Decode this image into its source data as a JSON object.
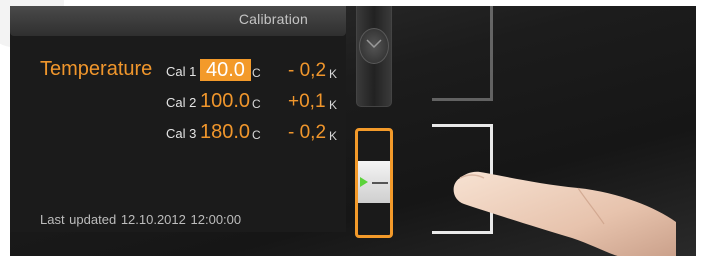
{
  "header": {
    "title": "Calibration"
  },
  "temperature_label": "Temperature",
  "calibrations": [
    {
      "label": "Cal 1",
      "value": "40.0",
      "unit": "C",
      "offset": "- 0,2",
      "offset_unit": "K",
      "selected": true
    },
    {
      "label": "Cal 2",
      "value": "100.0",
      "unit": "C",
      "offset": "+0,1",
      "offset_unit": "K",
      "selected": false
    },
    {
      "label": "Cal 3",
      "value": "180.0",
      "unit": "C",
      "offset": "- 0,2",
      "offset_unit": "K",
      "selected": false
    }
  ],
  "last_updated": {
    "label": "Last updated",
    "date": "12.10.2012",
    "time": "12:00:00"
  },
  "icons": {
    "scroll_up": "chevron-down-icon",
    "slider_marker": "triangle-marker-icon",
    "finger": "pointing-hand-icon"
  },
  "colors": {
    "accent": "#f39a2a",
    "text_light": "#e4e4e4",
    "marker_green": "#5bd33a"
  }
}
